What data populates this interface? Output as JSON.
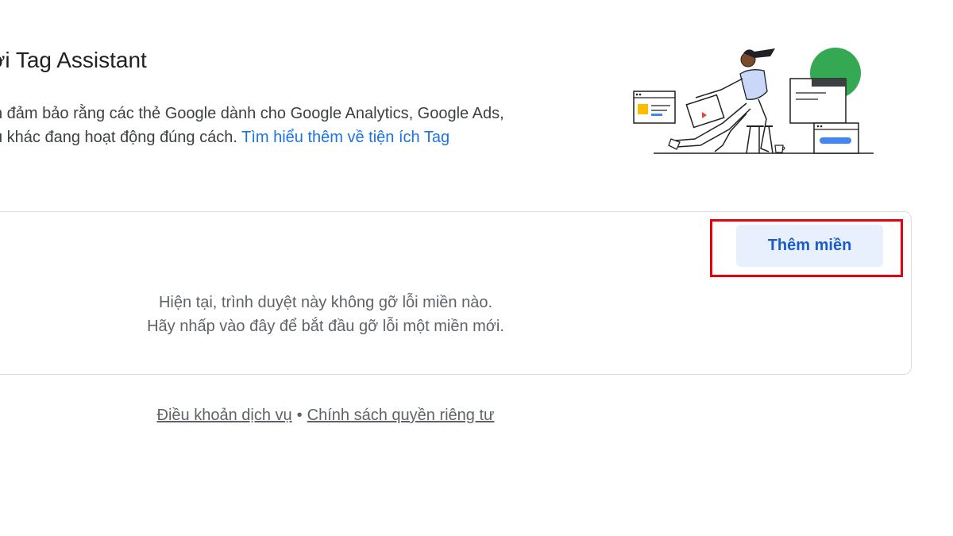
{
  "header": {
    "title": "ới Tag Assistant",
    "intro_line1": "n đảm bảo rằng các thẻ Google dành cho Google Analytics, Google Ads,",
    "intro_line2": "ụ khác đang hoạt động đúng cách.",
    "learn_more_link": "Tìm hiểu thêm về tiện ích Tag"
  },
  "domains_card": {
    "add_button_label": "Thêm miền",
    "empty_line1": "Hiện tại, trình duyệt này không gỡ lỗi miền nào.",
    "empty_line2": "Hãy nhấp vào đây để bắt đầu gỡ lỗi một miền mới."
  },
  "footer": {
    "terms_link": "Điều khoản dịch vụ",
    "separator": "•",
    "privacy_link": "Chính sách quyền riêng tư"
  },
  "colors": {
    "link": "#1a73e8",
    "button_bg": "#e8f0fe",
    "highlight": "#e8000b",
    "illustration_green": "#34a853",
    "illustration_yellow": "#fbbc04",
    "illustration_blue": "#4285f4"
  }
}
